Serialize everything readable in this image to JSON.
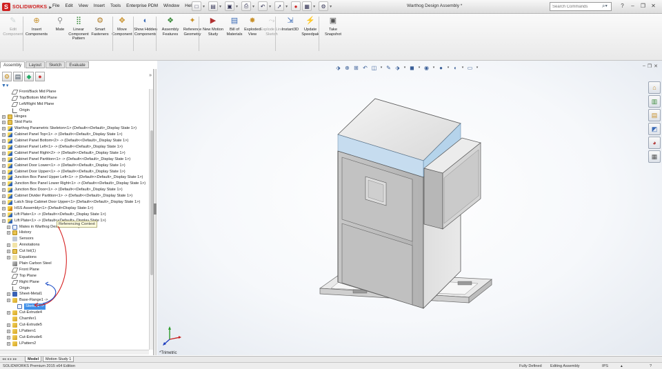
{
  "app": {
    "logo_text": "SOLIDWORKS",
    "document_title": "Warthog Design Assembly *"
  },
  "menu": [
    "File",
    "Edit",
    "View",
    "Insert",
    "Tools",
    "Enterprise PDM",
    "Window",
    "Help"
  ],
  "search": {
    "placeholder": "Search Commands"
  },
  "command_manager": {
    "buttons": [
      {
        "label": "Edit Component",
        "icon": "edit-component-icon",
        "enabled": false
      },
      {
        "label": "Insert Components",
        "icon": "insert-components-icon",
        "enabled": true
      },
      {
        "label": "Mate",
        "icon": "mate-icon",
        "enabled": true
      },
      {
        "label": "Linear Component Pattern",
        "icon": "linear-pattern-icon",
        "enabled": true
      },
      {
        "label": "Smart Fasteners",
        "icon": "smart-fasteners-icon",
        "enabled": true
      },
      {
        "label": "Move Component",
        "icon": "move-component-icon",
        "enabled": true
      },
      {
        "label": "Show Hidden Components",
        "icon": "show-hidden-icon",
        "enabled": true
      },
      {
        "label": "Assembly Features",
        "icon": "assembly-features-icon",
        "enabled": true
      },
      {
        "label": "Reference Geometry",
        "icon": "reference-geometry-icon",
        "enabled": true
      },
      {
        "label": "New Motion Study",
        "icon": "motion-study-icon",
        "enabled": true
      },
      {
        "label": "Bill of Materials",
        "icon": "bom-icon",
        "enabled": true
      },
      {
        "label": "Exploded View",
        "icon": "exploded-view-icon",
        "enabled": true
      },
      {
        "label": "Explode Line Sketch",
        "icon": "explode-line-icon",
        "enabled": false
      },
      {
        "label": "Instant3D",
        "icon": "instant3d-icon",
        "enabled": true
      },
      {
        "label": "Update Speedpak",
        "icon": "speedpak-icon",
        "enabled": true
      },
      {
        "label": "Take Snapshot",
        "icon": "snapshot-icon",
        "enabled": true
      }
    ],
    "tabs": [
      "Assembly",
      "Layout",
      "Sketch",
      "Evaluate"
    ],
    "active_tab": "Assembly"
  },
  "feature_tree": {
    "items": [
      {
        "label": "Front/Back Mid Plane",
        "icon": "plane-icon",
        "level": 1,
        "expander": false
      },
      {
        "label": "Top/Bottom Mid Plane",
        "icon": "plane-icon",
        "level": 1,
        "expander": false
      },
      {
        "label": "Left/Right Mid Plane",
        "icon": "plane-icon",
        "level": 1,
        "expander": false
      },
      {
        "label": "Origin",
        "icon": "origin-icon",
        "level": 1,
        "expander": false
      },
      {
        "label": "Hinges",
        "icon": "folder-icon",
        "level": 0,
        "expander": true
      },
      {
        "label": "Skid Parts",
        "icon": "folder-icon",
        "level": 0,
        "expander": true
      },
      {
        "label": "Warthog Parametric Skeleton<1> (Default<<Default>_Display State 1>)",
        "icon": "part-icon",
        "level": 0,
        "expander": true
      },
      {
        "label": "Cabinet Panel Top<1> -> (Default<<Default>_Display State 1>)",
        "icon": "part-icon",
        "level": 0,
        "expander": true
      },
      {
        "label": "Cabinet Panel Bottom<2> -> (Default<<Default>_Display State 1>)",
        "icon": "part-icon",
        "level": 0,
        "expander": true
      },
      {
        "label": "Cabinet Panel Left<1> -> (Default<<Default>_Display State 1>)",
        "icon": "part-icon",
        "level": 0,
        "expander": true
      },
      {
        "label": "Cabinet Panel Right<2> -> (Default<<Default>_Display State 1>)",
        "icon": "part-icon",
        "level": 0,
        "expander": true
      },
      {
        "label": "Cabinet Panel Partition<1> -> (Default<<Default>_Display State 1>)",
        "icon": "part-icon",
        "level": 0,
        "expander": true
      },
      {
        "label": "Cabinet Door Lower<1> -> (Default<<Default>_Display State 1>)",
        "icon": "part-icon",
        "level": 0,
        "expander": true
      },
      {
        "label": "Cabinet Door Upper<1> -> (Default<<Default>_Display State 1>)",
        "icon": "part-icon",
        "level": 0,
        "expander": true
      },
      {
        "label": "Junction Box Panel Upper Left<1> -> (Default<<Default>_Display State 1>)",
        "icon": "part-icon",
        "level": 0,
        "expander": true
      },
      {
        "label": "Junction Box Panel Lower Right<1> -> (Default<<Default>_Display State 1>)",
        "icon": "part-icon",
        "level": 0,
        "expander": true
      },
      {
        "label": "Junction Box Door<1> -> (Default<<Default>_Display State 1>)",
        "icon": "part-icon",
        "level": 0,
        "expander": true
      },
      {
        "label": "Cabinet Divider Partition<1> -> (Default<<Default>_Display State 1>)",
        "icon": "part-icon",
        "level": 0,
        "expander": true
      },
      {
        "label": "Latch Stop Cabinet Door Upper<1> (Default<<Default>_Display State 1>)",
        "icon": "part-icon",
        "level": 0,
        "expander": true
      },
      {
        "label": "HSS Assembly<1> (Default<Display State-1>)",
        "icon": "assembly-icon",
        "level": 0,
        "expander": true
      },
      {
        "label": "Lift Plate<1> -> (Default<<Default>_Display State 1>)",
        "icon": "part-icon",
        "level": 0,
        "expander": true
      },
      {
        "label": "Lift Plate<1> -> (Default<<Default>_Display State 1>)",
        "icon": "part-icon",
        "level": 0,
        "expander": true
      },
      {
        "label": "Mates in Warthog Design Assembly",
        "icon": "mates-icon",
        "level": 1,
        "expander": true
      },
      {
        "label": "History",
        "icon": "history-icon",
        "level": 1,
        "expander": true
      },
      {
        "label": "Sensors",
        "icon": "sensors-icon",
        "level": 1,
        "expander": false
      },
      {
        "label": "Annotations",
        "icon": "annotations-icon",
        "level": 1,
        "expander": true
      },
      {
        "label": "Cut list(1)",
        "icon": "cut-list-icon",
        "level": 1,
        "expander": true
      },
      {
        "label": "Equations",
        "icon": "equations-icon",
        "level": 1,
        "expander": true
      },
      {
        "label": "Plain Carbon Steel",
        "icon": "material-icon",
        "level": 1,
        "expander": false
      },
      {
        "label": "Front Plane",
        "icon": "plane-icon",
        "level": 1,
        "expander": false
      },
      {
        "label": "Top Plane",
        "icon": "plane-icon",
        "level": 1,
        "expander": false
      },
      {
        "label": "Right Plane",
        "icon": "plane-icon",
        "level": 1,
        "expander": false
      },
      {
        "label": "Origin",
        "icon": "origin-icon",
        "level": 1,
        "expander": false
      },
      {
        "label": "Sheet-Metal1",
        "icon": "sheet-metal-icon",
        "level": 1,
        "expander": true
      },
      {
        "label": "Base-Flange1 ->",
        "icon": "feature-icon",
        "level": 1,
        "expander": true
      },
      {
        "label": "Sketch1 ->",
        "icon": "sketch-icon",
        "level": 2,
        "expander": false
      },
      {
        "label": "Cut-Extrude4",
        "icon": "feature-icon",
        "level": 1,
        "expander": true
      },
      {
        "label": "Chamfer1",
        "icon": "feature-icon",
        "level": 1,
        "expander": false
      },
      {
        "label": "Cut-Extrude5",
        "icon": "feature-icon",
        "level": 1,
        "expander": true
      },
      {
        "label": "LPattern1",
        "icon": "feature-icon",
        "level": 1,
        "expander": true
      },
      {
        "label": "Cut-Extrude6",
        "icon": "feature-icon",
        "level": 1,
        "expander": true
      },
      {
        "label": "LPattern2",
        "icon": "feature-icon",
        "level": 1,
        "expander": true
      }
    ],
    "selected_label": "Sketch1 ->",
    "tooltip": "Referencing Context"
  },
  "graphics": {
    "view_orientation": "*Trimetric",
    "heads_up_icons": [
      "view-orientation-icon",
      "zoom-to-fit-icon",
      "zoom-to-area-icon",
      "previous-view-icon",
      "section-view-icon",
      "dynamic-annotation-icon",
      "view-orientation-icon",
      "display-style-icon",
      "hide-show-icon",
      "edit-appearance-icon",
      "apply-scene-icon",
      "view-settings-icon"
    ],
    "task_pane": [
      "solidworks-resources-icon",
      "design-library-icon",
      "file-explorer-icon",
      "view-palette-icon",
      "appearances-icon",
      "custom-properties-icon"
    ]
  },
  "bottom_tabs": [
    "Model",
    "Motion Study 1"
  ],
  "status": {
    "edition": "SOLIDWORKS Premium 2015 x64 Edition",
    "definition": "Fully Defined",
    "mode": "Editing Assembly",
    "units": "IPS"
  },
  "colors": {
    "accent": "#3d8ee8",
    "brand": "#cf1f1f"
  }
}
